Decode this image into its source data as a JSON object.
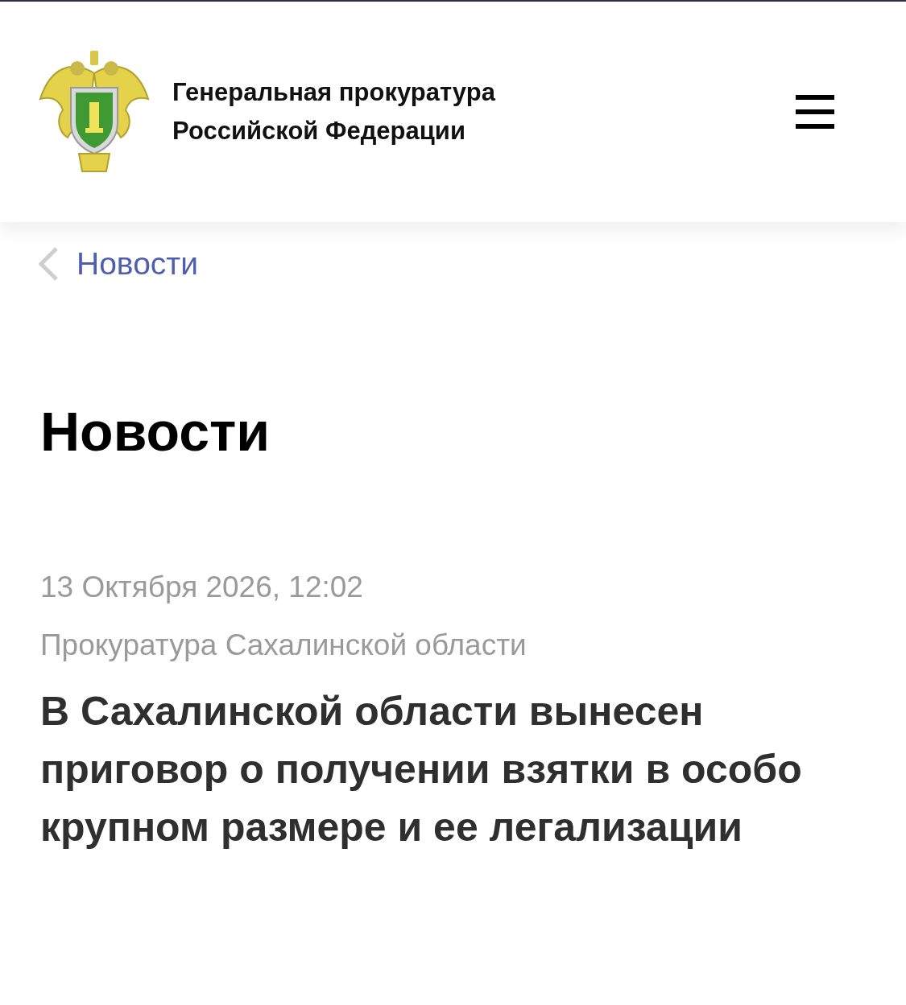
{
  "header": {
    "title": "Генеральная прокуратура Российской Федерации"
  },
  "breadcrumb": {
    "label": "Новости"
  },
  "page_title": "Новости",
  "article": {
    "date": "13 Октября 2026, 12:02",
    "source": "Прокуратура Сахалинской области",
    "headline": "В Сахалинской области вынесен приговор о получении взятки в особо крупном размере и ее легализации"
  }
}
